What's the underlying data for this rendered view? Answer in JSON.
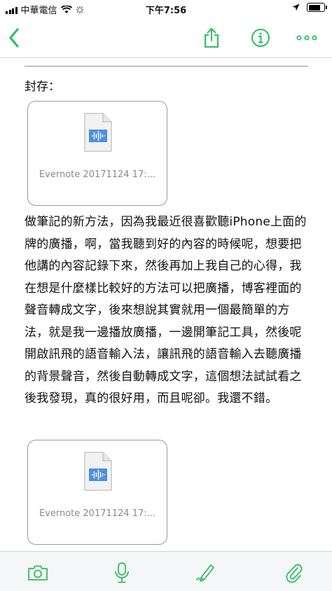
{
  "status_bar": {
    "carrier": "中華電信",
    "time": "下午7:56"
  },
  "note": {
    "archive_label": "封存：",
    "attachments": [
      {
        "filename": "Evernote 20171124 17:..."
      },
      {
        "filename": "Evernote 20171124 17:..."
      }
    ],
    "body": "做筆記的新方法，因為我最近很喜歡聽iPhone上面的牌的廣播，啊，當我聽到好的內容的時候呢，想要把他講的內容記錄下來，然後再加上我自己的心得，我在想是什麼樣比較好的方法可以把廣播，博客裡面的聲音轉成文字，後來想說其實就用一個最簡單的方法，就是我一邊播放廣播，一邊開筆記工具，然後呢開啟訊飛的語音輸入法，讓訊飛的語音輸入去聽廣播的背景聲音，然後自動轉成文字，這個想法試試看之後我發現，真的很好用，而且呢卻。我還不錯。"
  },
  "colors": {
    "accent": "#2dbe60",
    "icon_gray": "#8e8e93",
    "audio_blue": "#4f8fe0"
  },
  "icons": {
    "nav": [
      "back-chevron-icon",
      "share-icon",
      "info-icon",
      "more-icon"
    ],
    "toolbar": [
      "camera-icon",
      "microphone-icon",
      "pen-icon",
      "paperclip-icon"
    ]
  }
}
